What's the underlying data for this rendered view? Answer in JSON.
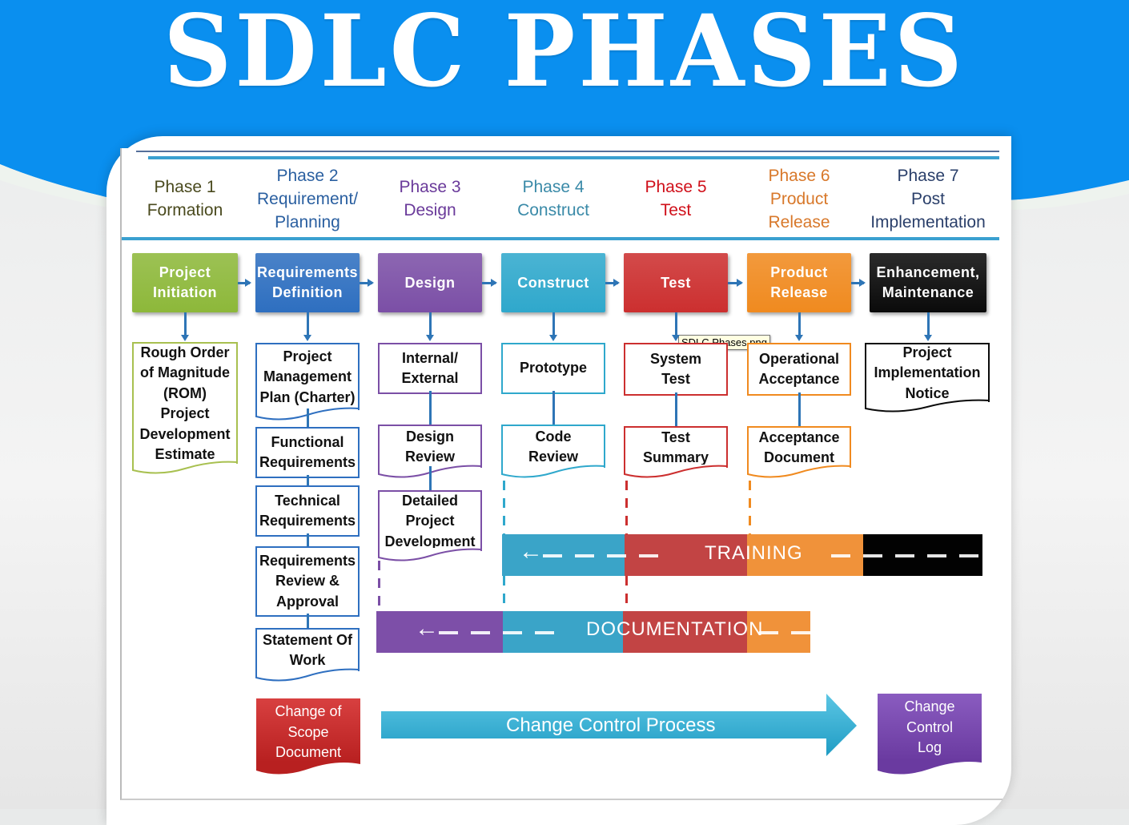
{
  "title": "SDLC PHASES",
  "colors": {
    "banner": "#0a8fef",
    "green": "#8db83a",
    "blue": "#2e6fc0",
    "purple": "#7b4fa6",
    "teal": "#2fa8cc",
    "red": "#cc2f2f",
    "orange": "#f08a1f",
    "black": "#0a0a0a"
  },
  "phases": [
    {
      "label": "Phase 1\nFormation",
      "color": "#4a4a1e",
      "box": "Project\nInitiation",
      "box_color": "#8db83a"
    },
    {
      "label": "Phase 2\nRequirement/\nPlanning",
      "color": "#2a5fa0",
      "box": "Requirements\nDefinition",
      "box_color": "#2e6fc0"
    },
    {
      "label": "Phase 3\nDesign",
      "color": "#6a3a9a",
      "box": "Design",
      "box_color": "#7b4fa6"
    },
    {
      "label": "Phase 4\nConstruct",
      "color": "#3a8aa8",
      "box": "Construct",
      "box_color": "#2fa8cc"
    },
    {
      "label": "Phase 5\nTest",
      "color": "#d0101a",
      "box": "Test",
      "box_color": "#cc2f2f"
    },
    {
      "label": "Phase 6\nProduct\nRelease",
      "color": "#d8782a",
      "box": "Product\nRelease",
      "box_color": "#f08a1f"
    },
    {
      "label": "Phase 7\nPost\nImplementation",
      "color": "#2a3f6a",
      "box": "Enhancement,\nMaintenance",
      "box_color": "#0a0a0a"
    }
  ],
  "deliverables": {
    "phase1": [
      "Rough Order\nof Magnitude\n(ROM)\nProject\nDevelopment\nEstimate"
    ],
    "phase2": [
      "Project\nManagement\nPlan (Charter)",
      "Functional\nRequirements",
      "Technical\nRequirements",
      "Requirements\nReview &\nApproval",
      "Statement Of\nWork"
    ],
    "phase3": [
      "Internal/\nExternal",
      "Design\nReview",
      "Detailed\nProject\nDevelopment"
    ],
    "phase4": [
      "Prototype",
      "Code\nReview"
    ],
    "phase5": [
      "System\nTest",
      "Test\nSummary"
    ],
    "phase6": [
      "Operational\nAcceptance",
      "Acceptance\nDocument"
    ],
    "phase7": [
      "Project\nImplementation\nNotice"
    ]
  },
  "bands": {
    "training": "TRAINING",
    "documentation": "DOCUMENTATION"
  },
  "change_control": {
    "start_doc": "Change of\nScope\nDocument",
    "process": "Change Control Process",
    "end_doc": "Change\nControl\nLog"
  },
  "tooltip": "SDLC Phases.png"
}
